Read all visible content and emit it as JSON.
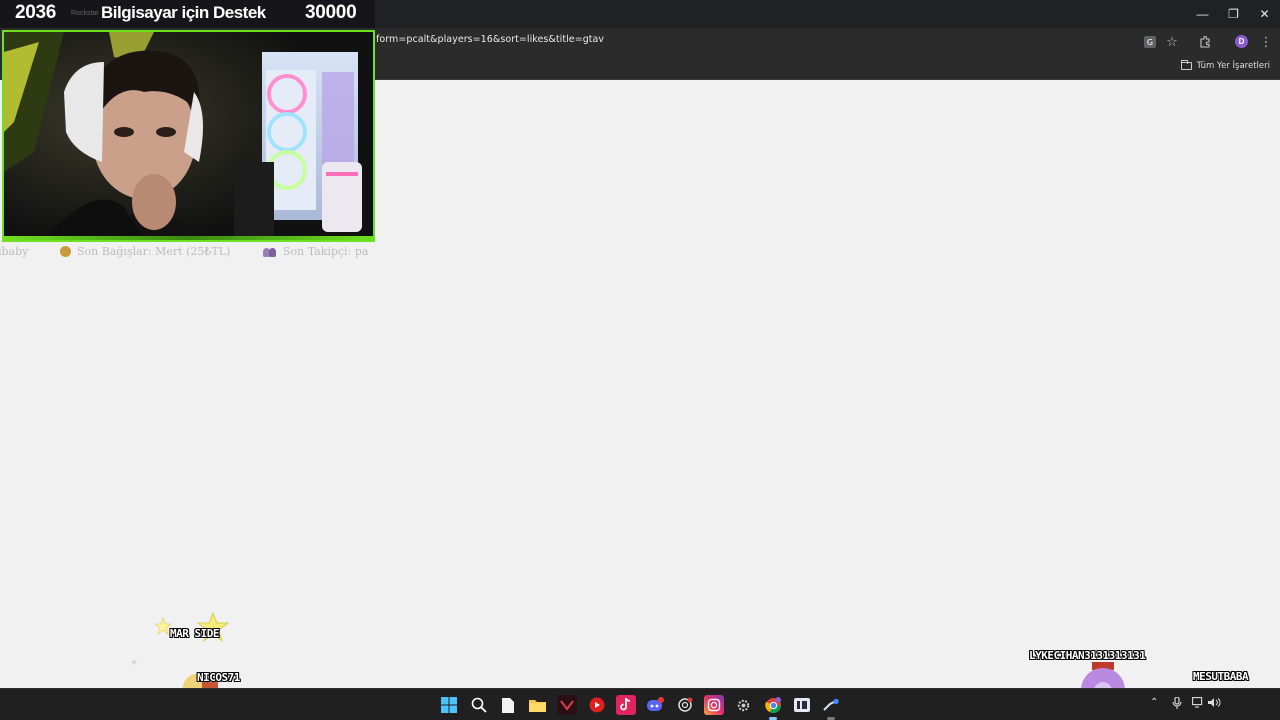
{
  "browser": {
    "url_text": "form=pcalt&players=16&sort=likes&title=gtav",
    "bookmarks_all_label": "Tüm Yer İşaretleri",
    "profile_initial": "D"
  },
  "overlay": {
    "banner_left": "2036",
    "banner_faint": "Rockstar",
    "banner_mid": "Bilgisayar için Destek",
    "banner_right": "30000",
    "ticker_items": [
      "ibaby",
      "Son Bağışlar: Mert (25₺TL)",
      "Son Takipçi: pa"
    ]
  },
  "chat_sprites": {
    "name_1": "MAR   SIDE",
    "name_2": "NICOS71",
    "name_3": "LYKECIHAN3131313131",
    "name_4": "MESUTBABA"
  },
  "taskbar": {
    "icons": [
      "windows-start",
      "search",
      "file",
      "file-explorer",
      "vscode",
      "youtube-music",
      "tiktok",
      "discord",
      "openai",
      "instagram",
      "settings",
      "chrome",
      "streamlabs",
      "steam"
    ],
    "tray_badges": {
      "chrome": "9",
      "discord": "99"
    }
  },
  "colors": {
    "accent_green": "#6fe01f",
    "chrome_dark": "#202124",
    "page_bg": "#f1f1f1"
  }
}
